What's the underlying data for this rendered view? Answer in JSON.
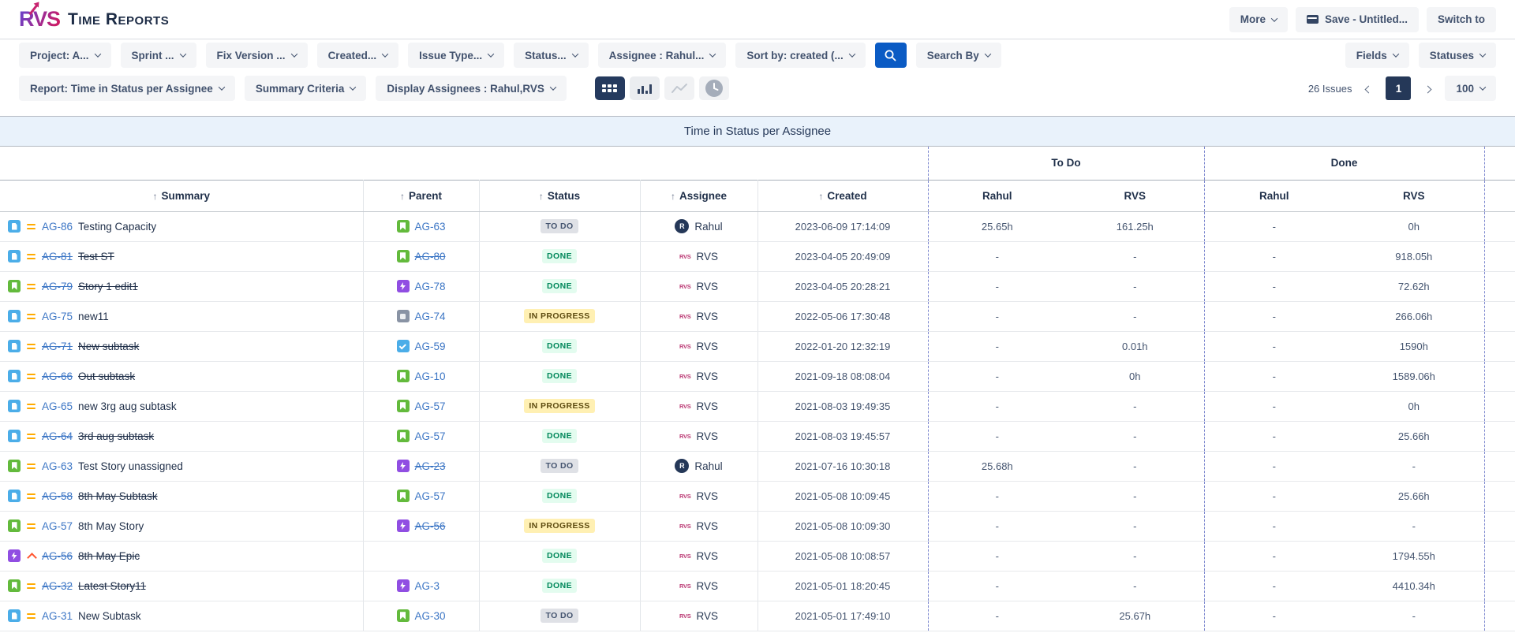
{
  "brand": {
    "logo_text": "RVS",
    "title": "Time Reports"
  },
  "topbar": {
    "more": "More",
    "save": "Save - Untitled...",
    "switch_to": "Switch to"
  },
  "filters": [
    "Project: A...",
    "Sprint ...",
    "Fix Version ...",
    "Created...",
    "Issue Type...",
    "Status...",
    "Assignee : Rahul...",
    "Sort by: created (..."
  ],
  "search_by": "Search By",
  "fields": "Fields",
  "statuses": "Statuses",
  "reportbar": {
    "report": "Report: Time in Status per Assignee",
    "summary_criteria": "Summary Criteria",
    "display_assignees": "Display Assignees : Rahul,RVS"
  },
  "view_icons": [
    "table-view",
    "bar-chart-view",
    "line-chart-view",
    "time-view"
  ],
  "pagination": {
    "issues_count": "26 Issues",
    "page": "1",
    "page_size": "100"
  },
  "report_title": "Time in Status per Assignee",
  "colors": {
    "accent_blue": "#0b5bc4",
    "link_blue": "#3c76c5",
    "selected_toggle": "#253a5e",
    "todo_bg": "#dfe1e6",
    "todo_text": "#44546f",
    "done_bg": "#e3fcef",
    "done_text": "#00875a",
    "inprogress_bg": "#fff0b3",
    "inprogress_text": "#5e4c11",
    "medium_priority": "#ffab00",
    "high_priority": "#ff5630",
    "brand_gradient_from": "#6f3fc4",
    "brand_gradient_to": "#d31a5f",
    "titlebar_bg": "#e9f2fb"
  },
  "table": {
    "groups": [
      "To Do",
      "Done"
    ],
    "columns": [
      "Summary",
      "Parent",
      "Status",
      "Assignee",
      "Created"
    ],
    "subcolumns": [
      "Rahul",
      "RVS",
      "Rahul",
      "RVS"
    ],
    "rows": [
      {
        "type": "subtask",
        "priority": "medium",
        "key": "AG-86",
        "struck": false,
        "summary": "Testing Capacity",
        "parent_type": "story",
        "parent_key": "AG-63",
        "parent_struck": false,
        "status": "TO DO",
        "status_kind": "todo",
        "assignee": "Rahul",
        "assignee_type": "user",
        "created": "2023-06-09 17:14:09",
        "values": [
          "25.65h",
          "161.25h",
          "-",
          "0h"
        ]
      },
      {
        "type": "subtask",
        "priority": "medium",
        "key": "AG-81",
        "struck": true,
        "summary": "Test ST",
        "parent_type": "story",
        "parent_key": "AG-80",
        "parent_struck": true,
        "status": "DONE",
        "status_kind": "done",
        "assignee": "RVS",
        "assignee_type": "rvs",
        "created": "2023-04-05 20:49:09",
        "values": [
          "-",
          "-",
          "-",
          "918.05h"
        ]
      },
      {
        "type": "story",
        "priority": "medium",
        "key": "AG-79",
        "struck": true,
        "summary": "Story 1 edit1",
        "parent_type": "epic",
        "parent_key": "AG-78",
        "parent_struck": false,
        "status": "DONE",
        "status_kind": "done",
        "assignee": "RVS",
        "assignee_type": "rvs",
        "created": "2023-04-05 20:28:21",
        "values": [
          "-",
          "-",
          "-",
          "72.62h"
        ]
      },
      {
        "type": "subtask",
        "priority": "medium",
        "key": "AG-75",
        "struck": false,
        "summary": "new11",
        "parent_type": "generic",
        "parent_key": "AG-74",
        "parent_struck": false,
        "status": "IN PROGRESS",
        "status_kind": "inprogress",
        "assignee": "RVS",
        "assignee_type": "rvs",
        "created": "2022-05-06 17:30:48",
        "values": [
          "-",
          "-",
          "-",
          "266.06h"
        ]
      },
      {
        "type": "subtask",
        "priority": "medium",
        "key": "AG-71",
        "struck": true,
        "summary": "New subtask",
        "parent_type": "task",
        "parent_key": "AG-59",
        "parent_struck": false,
        "status": "DONE",
        "status_kind": "done",
        "assignee": "RVS",
        "assignee_type": "rvs",
        "created": "2022-01-20 12:32:19",
        "values": [
          "-",
          "0.01h",
          "-",
          "1590h"
        ]
      },
      {
        "type": "subtask",
        "priority": "medium",
        "key": "AG-66",
        "struck": true,
        "summary": "Out subtask",
        "parent_type": "story",
        "parent_key": "AG-10",
        "parent_struck": false,
        "status": "DONE",
        "status_kind": "done",
        "assignee": "RVS",
        "assignee_type": "rvs",
        "created": "2021-09-18 08:08:04",
        "values": [
          "-",
          "0h",
          "-",
          "1589.06h"
        ]
      },
      {
        "type": "subtask",
        "priority": "medium",
        "key": "AG-65",
        "struck": false,
        "summary": "new 3rg aug subtask",
        "parent_type": "story",
        "parent_key": "AG-57",
        "parent_struck": false,
        "status": "IN PROGRESS",
        "status_kind": "inprogress",
        "assignee": "RVS",
        "assignee_type": "rvs",
        "created": "2021-08-03 19:49:35",
        "values": [
          "-",
          "-",
          "-",
          "0h"
        ]
      },
      {
        "type": "subtask",
        "priority": "medium",
        "key": "AG-64",
        "struck": true,
        "summary": "3rd aug subtask",
        "parent_type": "story",
        "parent_key": "AG-57",
        "parent_struck": false,
        "status": "DONE",
        "status_kind": "done",
        "assignee": "RVS",
        "assignee_type": "rvs",
        "created": "2021-08-03 19:45:57",
        "values": [
          "-",
          "-",
          "-",
          "25.66h"
        ]
      },
      {
        "type": "story",
        "priority": "medium",
        "key": "AG-63",
        "struck": false,
        "summary": "Test Story unassigned",
        "parent_type": "epic",
        "parent_key": "AG-23",
        "parent_struck": true,
        "status": "TO DO",
        "status_kind": "todo",
        "assignee": "Rahul",
        "assignee_type": "user",
        "created": "2021-07-16 10:30:18",
        "values": [
          "25.68h",
          "-",
          "-",
          "-"
        ]
      },
      {
        "type": "subtask",
        "priority": "medium",
        "key": "AG-58",
        "struck": true,
        "summary": "8th May Subtask",
        "parent_type": "story",
        "parent_key": "AG-57",
        "parent_struck": false,
        "status": "DONE",
        "status_kind": "done",
        "assignee": "RVS",
        "assignee_type": "rvs",
        "created": "2021-05-08 10:09:45",
        "values": [
          "-",
          "-",
          "-",
          "25.66h"
        ]
      },
      {
        "type": "story",
        "priority": "medium",
        "key": "AG-57",
        "struck": false,
        "summary": "8th May Story",
        "parent_type": "epic",
        "parent_key": "AG-56",
        "parent_struck": true,
        "status": "IN PROGRESS",
        "status_kind": "inprogress",
        "assignee": "RVS",
        "assignee_type": "rvs",
        "created": "2021-05-08 10:09:30",
        "values": [
          "-",
          "-",
          "-",
          "-"
        ]
      },
      {
        "type": "epic",
        "priority": "high",
        "key": "AG-56",
        "struck": true,
        "summary": "8th May Epic",
        "parent_type": "",
        "parent_key": "",
        "parent_struck": false,
        "status": "DONE",
        "status_kind": "done",
        "assignee": "RVS",
        "assignee_type": "rvs",
        "created": "2021-05-08 10:08:57",
        "values": [
          "-",
          "-",
          "-",
          "1794.55h"
        ]
      },
      {
        "type": "story",
        "priority": "medium",
        "key": "AG-32",
        "struck": true,
        "summary": "Latest Story11",
        "parent_type": "epic",
        "parent_key": "AG-3",
        "parent_struck": false,
        "status": "DONE",
        "status_kind": "done",
        "assignee": "RVS",
        "assignee_type": "rvs",
        "created": "2021-05-01 18:20:45",
        "values": [
          "-",
          "-",
          "-",
          "4410.34h"
        ]
      },
      {
        "type": "subtask",
        "priority": "medium",
        "key": "AG-31",
        "struck": false,
        "summary": "New Subtask",
        "parent_type": "story",
        "parent_key": "AG-30",
        "parent_struck": false,
        "status": "TO DO",
        "status_kind": "todo",
        "assignee": "RVS",
        "assignee_type": "rvs",
        "created": "2021-05-01 17:49:10",
        "values": [
          "-",
          "25.67h",
          "-",
          "-"
        ]
      }
    ]
  }
}
